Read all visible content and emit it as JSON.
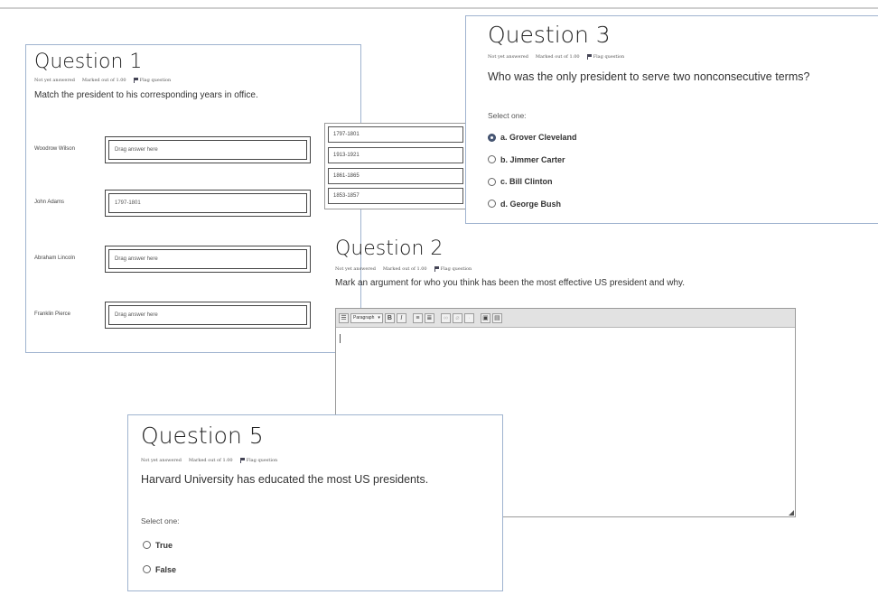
{
  "question1": {
    "title": "Question 1",
    "status": "Not yet answered",
    "marked_out_of": "Marked out of 1.00",
    "flag_label": "Flag question",
    "text": "Match the president to his corresponding years in office.",
    "rows": [
      {
        "president": "Woodrow Wilson",
        "answer": "Drag answer here"
      },
      {
        "president": "John Adams",
        "answer": "1797-1801"
      },
      {
        "president": "Abraham Lincoln",
        "answer": "Drag answer here"
      },
      {
        "president": "Franklin Pierce",
        "answer": "Drag answer here"
      }
    ],
    "answer_bank": [
      "1797-1801",
      "1913-1921",
      "1861-1865",
      "1853-1857"
    ]
  },
  "question3": {
    "title": "Question 3",
    "status": "Not yet answered",
    "marked_out_of": "Marked out of 1.00",
    "flag_label": "Flag question",
    "text": "Who was the only president to serve two nonconsecutive terms?",
    "select_label": "Select one:",
    "options": [
      {
        "label": "a. Grover Cleveland",
        "selected": true
      },
      {
        "label": "b. Jimmer Carter",
        "selected": false
      },
      {
        "label": "c. Bill Clinton",
        "selected": false
      },
      {
        "label": "d. George Bush",
        "selected": false
      }
    ]
  },
  "question2": {
    "title": "Question 2",
    "status": "Not yet answered",
    "marked_out_of": "Marked out of 1.00",
    "flag_label": "Flag question",
    "text": "Mark an argument for who you think has been the most effective US president and why.",
    "editor": {
      "format_select": "Paragraph",
      "bold": "B",
      "italic": "I",
      "content": ""
    }
  },
  "question5": {
    "title": "Question 5",
    "status": "Not yet answered",
    "marked_out_of": "Marked out of 1.00",
    "flag_label": "Flag question",
    "text": "Harvard University has educated the most US presidents.",
    "select_label": "Select one:",
    "options": [
      {
        "label": "True",
        "selected": false
      },
      {
        "label": "False",
        "selected": false
      }
    ]
  },
  "colors": {
    "card_border": "#9fb3cf",
    "radio_selected": "#4a5a78",
    "toolbar_bg": "#e2e2e2"
  }
}
